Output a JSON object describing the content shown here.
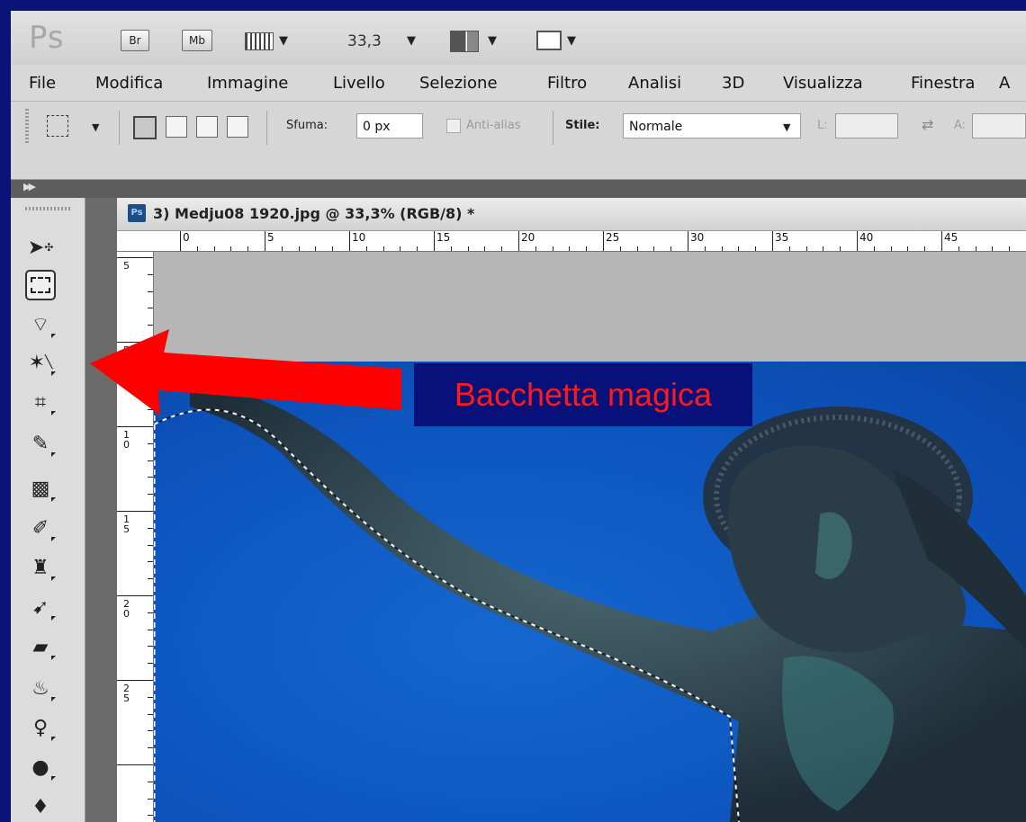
{
  "app": {
    "logo": "Ps",
    "bridge_label": "Br",
    "minibridge_label": "Mb",
    "zoom_value": "33,3"
  },
  "menu": {
    "items": [
      "File",
      "Modifica",
      "Immagine",
      "Livello",
      "Selezione",
      "Filtro",
      "Analisi",
      "3D",
      "Visualizza",
      "Finestra",
      "A"
    ]
  },
  "options": {
    "feather_label": "Sfuma:",
    "feather_value": "0 px",
    "antialias_label": "Anti-alias",
    "style_label": "Stile:",
    "style_value": "Normale",
    "width_label": "L:",
    "height_label": "A:"
  },
  "document": {
    "title": "3) Medju08 1920.jpg @ 33,3% (RGB/8) *",
    "ps_badge": "Ps",
    "ruler_h_labels": [
      "0",
      "5",
      "10",
      "15",
      "20",
      "25",
      "30",
      "35",
      "40",
      "45"
    ],
    "ruler_v_labels": [
      "5",
      "5",
      "10",
      "15",
      "20",
      "25"
    ]
  },
  "annotation": {
    "text": "Bacchetta magica",
    "text_color": "#ff1a1a",
    "box_color": "#08107a",
    "arrow_color": "#ff0000"
  },
  "colors": {
    "slide_background": "#0a1478",
    "sky": "#0d55bf"
  },
  "toolbox": {
    "tools": [
      "move-tool-icon",
      "rectangular-marquee-icon",
      "lasso-icon",
      "magic-wand-icon",
      "crop-icon",
      "eyedropper-icon",
      "spot-healing-icon",
      "brush-icon",
      "clone-stamp-icon",
      "history-brush-icon",
      "eraser-icon",
      "paint-bucket-icon",
      "blur-icon",
      "dodge-icon"
    ]
  }
}
